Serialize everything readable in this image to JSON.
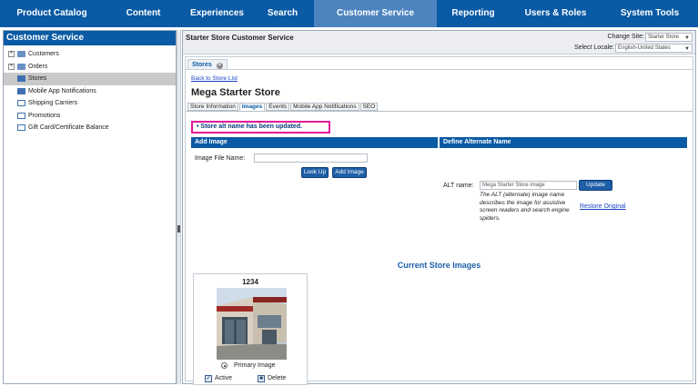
{
  "topnav": {
    "items": [
      {
        "label": "Product Catalog"
      },
      {
        "label": "Content"
      },
      {
        "label": "Experiences"
      },
      {
        "label": "Search"
      },
      {
        "label": "Customer Service"
      },
      {
        "label": "Reporting"
      },
      {
        "label": "Users & Roles"
      },
      {
        "label": "System Tools"
      }
    ],
    "active_index": 4,
    "color": "#0a5aa5",
    "active_color": "#4d84c0"
  },
  "sidebar": {
    "title": "Customer Service",
    "items": [
      {
        "label": "Customers",
        "icon": "folder-icon",
        "expandable": true
      },
      {
        "label": "Orders",
        "icon": "folder-icon",
        "expandable": true
      },
      {
        "label": "Stores",
        "icon": "store-icon",
        "selected": true
      },
      {
        "label": "Mobile App Notifications",
        "icon": "store-icon"
      },
      {
        "label": "Shipping Carriers",
        "icon": "truck-icon"
      },
      {
        "label": "Promotions",
        "icon": "doc-icon"
      },
      {
        "label": "Gift Card/Certificate Balance",
        "icon": "doc-icon"
      }
    ]
  },
  "header": {
    "title": "Starter Store Customer Service",
    "site_label": "Change Site:",
    "site_value": "Starter Store",
    "locale_label": "Select Locale:",
    "locale_value": "English-United States"
  },
  "doc_tab": {
    "label": "Stores"
  },
  "page": {
    "back_link": "Back to Store List",
    "store_title": "Mega Starter Store",
    "tabs": [
      "Store Information",
      "Images",
      "Events",
      "Mobile App Notifications",
      "SEO"
    ],
    "active_tab_index": 1,
    "message": "• Store alt name has been updated."
  },
  "add_image": {
    "title": "Add Image",
    "file_label": "Image File Name:",
    "lookup_button": "Look Up",
    "add_button": "Add Image"
  },
  "alt_name": {
    "title": "Define Alternate Name",
    "label": "ALT name:",
    "value": "Mega Starter Store image",
    "update_button": "Update",
    "description": "The ALT (alternate) image name describes the image for assistive screen readers and search engine spiders.",
    "restore_link": "Restore Original"
  },
  "current_images": {
    "title": "Current Store Images",
    "items": [
      {
        "name": "1234",
        "primary_label": "Primary Image",
        "active_label": "Active",
        "delete_label": "Delete"
      }
    ]
  }
}
